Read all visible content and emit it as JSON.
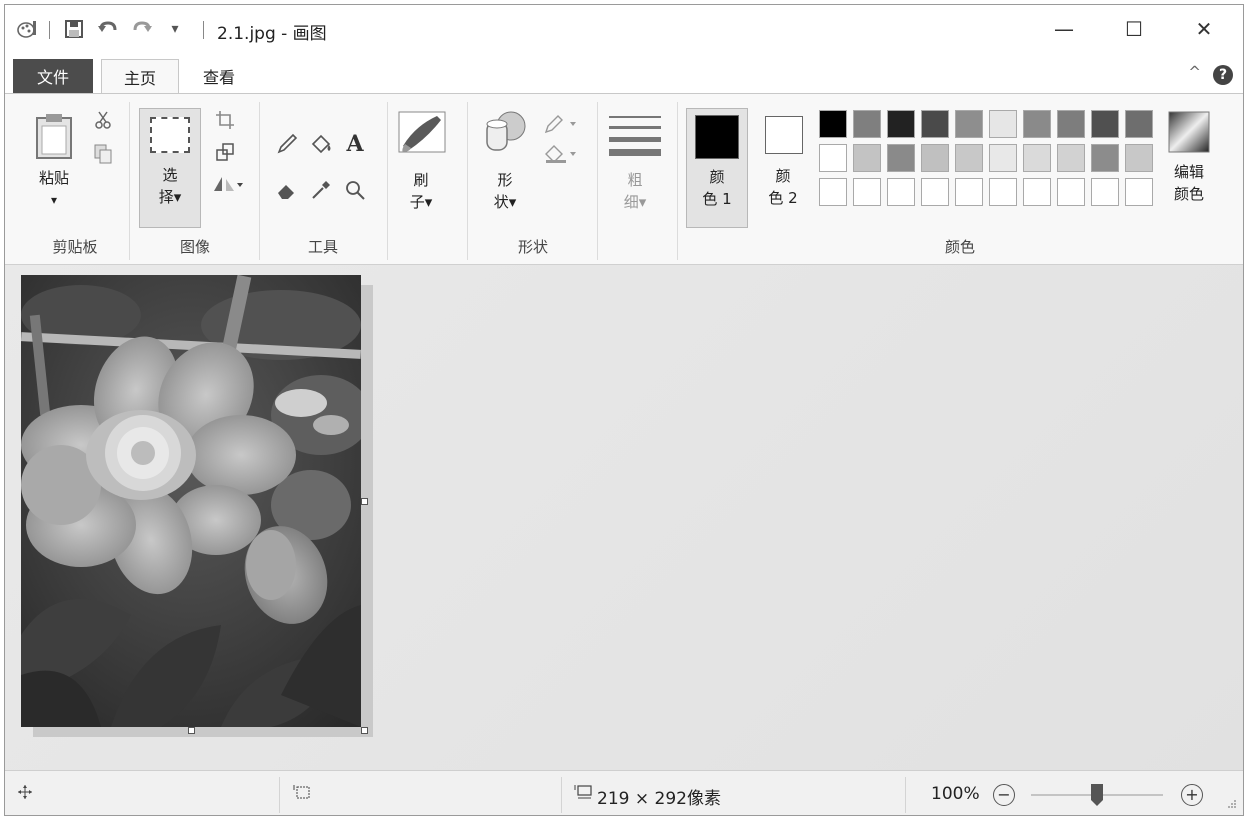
{
  "titlebar": {
    "title": "2.1.jpg - 画图",
    "qa_dropdown": "▾",
    "minimize": "—",
    "maximize": "☐",
    "close": "✕"
  },
  "tabs": {
    "file": "文件",
    "home": "主页",
    "view": "查看",
    "collapse": "^",
    "help": "?"
  },
  "ribbon": {
    "clipboard": {
      "paste": "粘贴",
      "paste_arrow": "▾",
      "group": "剪贴板"
    },
    "image": {
      "select_line1": "选",
      "select_line2": "择▾",
      "group": "图像"
    },
    "tools": {
      "group": "工具",
      "text_tool": "A"
    },
    "brushes": {
      "line1": "刷",
      "line2": "子▾"
    },
    "shapes": {
      "line1": "形",
      "line2": "状▾",
      "group": "形状"
    },
    "size": {
      "line1": "粗",
      "line2": "细▾"
    },
    "colors": {
      "color1_line1": "颜",
      "color1_line2": "色 1",
      "color2_line1": "颜",
      "color2_line2": "色 2",
      "edit_line1": "编辑",
      "edit_line2": "颜色",
      "group": "颜色",
      "color1_value": "#000000",
      "color2_value": "#ffffff",
      "palette": [
        [
          "#000000",
          "#7f7f7f",
          "#222222",
          "#4a4a4a",
          "#8e8e8e",
          "#e6e6e6",
          "#8a8a8a",
          "#7d7d7d",
          "#505050",
          "#6e6e6e"
        ],
        [
          "#ffffff",
          "#c3c3c3",
          "#8a8a8a",
          "#c0c0c0",
          "#c8c8c8",
          "#e8e8e8",
          "#dadada",
          "#d2d2d2",
          "#8c8c8c",
          "#c8c8c8"
        ],
        [
          "#ffffff",
          "#ffffff",
          "#ffffff",
          "#ffffff",
          "#ffffff",
          "#ffffff",
          "#ffffff",
          "#ffffff",
          "#ffffff",
          "#ffffff"
        ]
      ]
    }
  },
  "statusbar": {
    "image_size": "219 × 292像素",
    "zoom": "100%",
    "zoom_out": "−",
    "zoom_in": "+",
    "zoom_level": 0.5
  }
}
